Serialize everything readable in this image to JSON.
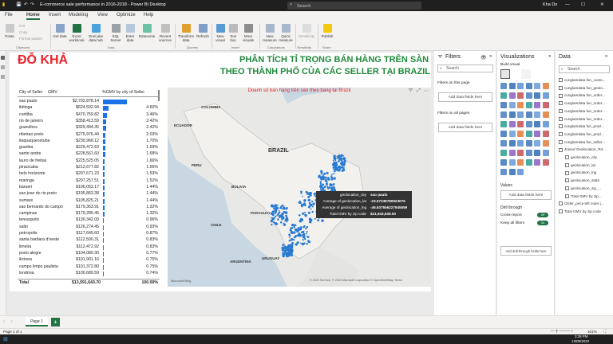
{
  "window": {
    "title": "E-commerce sale performance in 2016-2018 - Power BI Desktop",
    "search_placeholder": "Search",
    "user": "Kha Do"
  },
  "menu_tabs": [
    "File",
    "Home",
    "Insert",
    "Modeling",
    "View",
    "Optimize",
    "Help"
  ],
  "ribbon": {
    "clipboard": [
      "Paste",
      "Cut",
      "Copy",
      "Format painter"
    ],
    "buttons": [
      "Get data",
      "Excel workbook",
      "OneLake data hub",
      "SQL Server",
      "Enter data",
      "Dataverse",
      "Recent sources",
      "Transform data",
      "Refresh",
      "New visual",
      "Text box",
      "More visuals",
      "New measure",
      "Quick measure",
      "Sensitivity",
      "Publish"
    ],
    "groups": [
      "Clipboard",
      "Data",
      "Queries",
      "Insert",
      "Calculations",
      "Sensitivity",
      "Share"
    ]
  },
  "report": {
    "brand": "ĐỖ KHẢ",
    "title_line1": "PHÂN TÍCH TỈ TRỌNG BÁN HÀNG TRÊN SÀN",
    "title_line2": "THEO THÀNH PHỐ CỦA CÁC SELLER TẠI BRAZIL"
  },
  "table": {
    "headers": [
      "City of Seller",
      "GMV",
      "%GMV by city of Seller"
    ],
    "rows": [
      [
        "sao paulo",
        "$2,702,878.14",
        "19.95%"
      ],
      [
        "ibitinga",
        "$624,592.94",
        "4.60%"
      ],
      [
        "curitiba",
        "$470,759.82",
        "3.46%"
      ],
      [
        "rio de janeiro",
        "$358,413.59",
        "2.42%"
      ],
      [
        "guarulhos",
        "$329,494.35",
        "2.42%"
      ],
      [
        "ribeirao preto",
        "$275,976.44",
        "2.03%"
      ],
      [
        "itaquaquecetuba",
        "$230,968.12",
        "1.70%"
      ],
      [
        "guariba",
        "$229,472.63",
        "1.69%"
      ],
      [
        "santo andre",
        "$228,561.60",
        "1.68%"
      ],
      [
        "lauro de freitas",
        "$225,525.05",
        "1.66%"
      ],
      [
        "piracicaba",
        "$212,677.82",
        "1.56%"
      ],
      [
        "belo horizonte",
        "$207,671.23",
        "1.53%"
      ],
      [
        "maringa",
        "$207,257.51",
        "1.52%"
      ],
      [
        "barueri",
        "$196,053.17",
        "1.44%"
      ],
      [
        "sao jose do rio preto",
        "$195,863.38",
        "1.44%"
      ],
      [
        "sumare",
        "$195,825.21",
        "1.44%"
      ],
      [
        "sao bernardo do campo",
        "$179,363.91",
        "1.32%"
      ],
      [
        "campinas",
        "$179,285.45",
        "1.32%"
      ],
      [
        "teresopolis",
        "$130,342.09",
        "0.96%"
      ],
      [
        "salto",
        "$126,274.45",
        "0.93%"
      ],
      [
        "petropolis",
        "$117,649.60",
        "0.87%"
      ],
      [
        "santa barbara d'oeste",
        "$112,500.31",
        "0.83%"
      ],
      [
        "limeira",
        "$112,472.92",
        "0.83%"
      ],
      [
        "porto alegre",
        "$104,080.30",
        "0.77%"
      ],
      [
        "ilicinea",
        "$101,901.16",
        "0.75%"
      ],
      [
        "campo limpo paulista",
        "$101,372.80",
        "0.75%"
      ],
      [
        "londrina",
        "$100,689.59",
        "0.74%"
      ]
    ],
    "total": [
      "Total",
      "$13,591,643.70",
      "100.00%"
    ],
    "bar_color": "#1a73e8"
  },
  "map": {
    "title": "Doanh số bán hàng trên sàn theo bang tại Brazil",
    "labels": [
      "COLOMBIA",
      "ECUADOR",
      "PERU",
      "BRAZIL",
      "BOLIVIA",
      "PARAGUAY",
      "CHILE",
      "URUGUAY",
      "ARGENTINA"
    ],
    "attribution": "© 2023 TomTom, © 2023 Microsoft Corporation © OpenStreetMap Terms",
    "bing": "Microsoft Bing",
    "tooltip": [
      [
        "geolocation_city",
        "sao paulo"
      ],
      [
        "Average of geolocation_lat",
        "-23.57338780923075"
      ],
      [
        "Average of geolocation_lng",
        "-46.637556227945559"
      ],
      [
        "Total GMV by zip code",
        "$21,943,638.00"
      ]
    ]
  },
  "filters": {
    "title": "Filters",
    "search": "Search",
    "on_page": "Filters on this page",
    "all_pages": "Filters on all pages",
    "add": "Add data fields here"
  },
  "visualizations": {
    "title": "Visualizations",
    "build": "Build visual",
    "values": "Values",
    "values_add": "Add data fields here",
    "drill": "Drill through",
    "cross": "Cross-report",
    "cross_state": "Off",
    "keep": "Keep all filters",
    "keep_state": "On",
    "drill_add": "Add drill-through fields here"
  },
  "data": {
    "title": "Data",
    "search": "Search",
    "tables": [
      "cunglamdata fun_custo...",
      "cunglamdata fun_geolo...",
      "cunglamdata fun_order...",
      "cunglamdata fun_order...",
      "cunglamdata fun_order...",
      "cunglamdata fun_order...",
      "cunglamdata fun_prod...",
      "cunglamdata fun_prod...",
      "cunglamdata fun_seller..."
    ],
    "joined": "Joined Geolocation_Tot...",
    "fields": [
      "geolocation_city",
      "geolocation_lat",
      "geolocation_lng",
      "geolocation_state",
      "geolocation_zip_...",
      "Total GMV by zip..."
    ],
    "others": [
      "Order_price left outer j...",
      "Total GMV by zip code"
    ]
  },
  "pages": [
    "Page 1"
  ],
  "status": {
    "page": "Page 1 of 1",
    "zoom": "101%"
  },
  "taskbar": {
    "time": "3:28 PM",
    "date": "13/09/2023"
  }
}
